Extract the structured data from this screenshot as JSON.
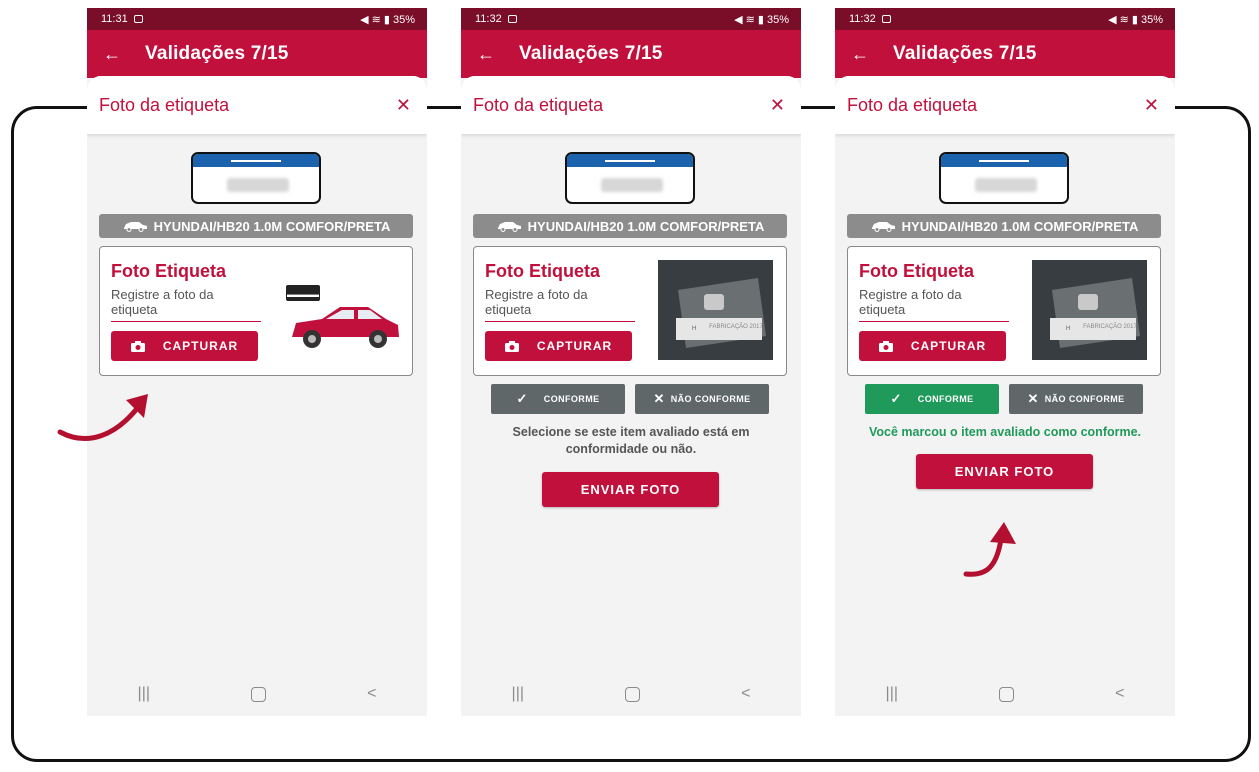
{
  "colors": {
    "primary": "#c2103d",
    "status_bar": "#7a0d28",
    "success": "#1f9a5a",
    "neutral_button": "#5f6768",
    "car_bar": "#8c8c8c"
  },
  "screens": [
    {
      "time": "11:31",
      "battery": "35%",
      "title": "Validações 7/15",
      "sheet_title": "Foto da etiqueta",
      "vehicle": "HYUNDAI/HB20 1.0M COMFOR/PRETA",
      "card_title": "Foto Etiqueta",
      "card_subtitle": "Registre a foto da etiqueta",
      "capture_label": "CAPTURAR",
      "plate_text": "PZ15J67"
    },
    {
      "time": "11:32",
      "battery": "35%",
      "title": "Validações 7/15",
      "sheet_title": "Foto da etiqueta",
      "vehicle": "HYUNDAI/HB20 1.0M COMFOR/PRETA",
      "card_title": "Foto Etiqueta",
      "card_subtitle": "Registre a foto da etiqueta",
      "capture_label": "CAPTURAR",
      "plate_text": "PZ15J67",
      "label_photo_text": "FABRICAÇÃO 2017",
      "conforme_label": "CONFORME",
      "nao_conforme_label": "NÃO CONFORME",
      "hint": "Selecione se este item avaliado está em conformidade ou não.",
      "send_label": "ENVIAR FOTO"
    },
    {
      "time": "11:32",
      "battery": "35%",
      "title": "Validações 7/15",
      "sheet_title": "Foto da etiqueta",
      "vehicle": "HYUNDAI/HB20 1.0M COMFOR/PRETA",
      "card_title": "Foto Etiqueta",
      "card_subtitle": "Registre a foto da etiqueta",
      "capture_label": "CAPTURAR",
      "plate_text": "PZ15J67",
      "label_photo_text": "FABRICAÇÃO 2017",
      "conforme_label": "CONFORME",
      "nao_conforme_label": "NÃO CONFORME",
      "hint": "Você marcou o item avaliado como conforme.",
      "send_label": "ENVIAR FOTO"
    }
  ]
}
